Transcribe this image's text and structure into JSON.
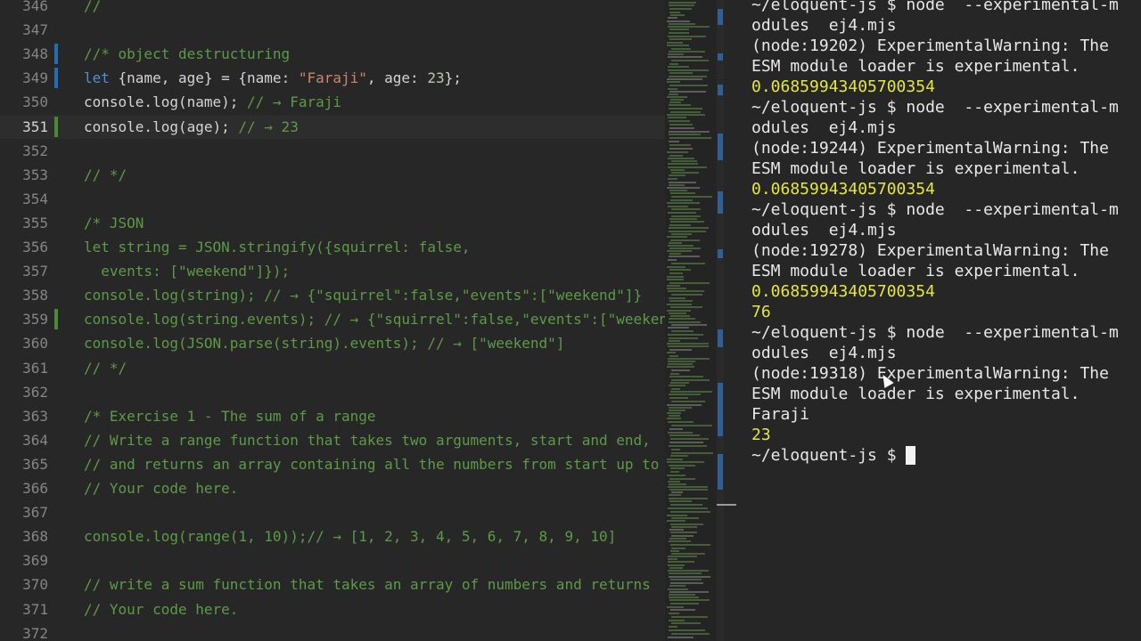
{
  "editor": {
    "current_line": "351",
    "lines": [
      {
        "n": "346",
        "seg": [
          {
            "t": "// ",
            "c": "cm"
          }
        ]
      },
      {
        "n": "347",
        "seg": []
      },
      {
        "n": "348",
        "mark": "#1f6fb2",
        "seg": [
          {
            "t": "//* object destructuring",
            "c": "cm"
          }
        ]
      },
      {
        "n": "349",
        "mark": "#1f6fb2",
        "seg": [
          {
            "t": "let",
            "c": "kw"
          },
          {
            "t": " {name, age} = {name: ",
            "c": ""
          },
          {
            "t": "\"Faraji\"",
            "c": "str"
          },
          {
            "t": ", age: ",
            "c": ""
          },
          {
            "t": "23",
            "c": "num"
          },
          {
            "t": "};",
            "c": ""
          }
        ]
      },
      {
        "n": "350",
        "seg": [
          {
            "t": "console.log(name); ",
            "c": ""
          },
          {
            "t": "// → Faraji",
            "c": "cm"
          }
        ]
      },
      {
        "n": "351",
        "mark": "#4a8a34",
        "cur": true,
        "seg": [
          {
            "t": "console.log(age); ",
            "c": ""
          },
          {
            "t": "// → 23",
            "c": "cm"
          }
        ]
      },
      {
        "n": "352",
        "seg": []
      },
      {
        "n": "353",
        "seg": [
          {
            "t": "// */",
            "c": "cm"
          }
        ]
      },
      {
        "n": "354",
        "seg": []
      },
      {
        "n": "355",
        "seg": [
          {
            "t": "/* JSON",
            "c": "cm"
          }
        ]
      },
      {
        "n": "356",
        "seg": [
          {
            "t": "let string = JSON.stringify({squirrel: false,",
            "c": "cm"
          }
        ]
      },
      {
        "n": "357",
        "seg": [
          {
            "t": "  events: [\"weekend\"]});",
            "c": "cm"
          }
        ]
      },
      {
        "n": "358",
        "seg": [
          {
            "t": "console.log(string); // → {\"squirrel\":false,\"events\":[\"weekend\"]}",
            "c": "cm"
          }
        ]
      },
      {
        "n": "359",
        "mark": "#4a8a34",
        "seg": [
          {
            "t": "console.log(string.events); // → {\"squirrel\":false,\"events\":[\"weekend\"]}",
            "c": "cm"
          }
        ]
      },
      {
        "n": "360",
        "seg": [
          {
            "t": "console.log(JSON.parse(string).events); // → [\"weekend\"]",
            "c": "cm"
          }
        ]
      },
      {
        "n": "361",
        "seg": [
          {
            "t": "// */",
            "c": "cm"
          }
        ]
      },
      {
        "n": "362",
        "seg": []
      },
      {
        "n": "363",
        "seg": [
          {
            "t": "/* Exercise 1 - The sum of a range",
            "c": "cm"
          }
        ]
      },
      {
        "n": "364",
        "seg": [
          {
            "t": "// Write a range function that takes two arguments, start and end,",
            "c": "cm"
          }
        ]
      },
      {
        "n": "365",
        "seg": [
          {
            "t": "// and returns an array containing all the numbers from start up to",
            "c": "cm"
          }
        ]
      },
      {
        "n": "366",
        "seg": [
          {
            "t": "// Your code here.",
            "c": "cm"
          }
        ]
      },
      {
        "n": "367",
        "seg": []
      },
      {
        "n": "368",
        "seg": [
          {
            "t": "console.log(range(1, 10));// → [1, 2, 3, 4, 5, 6, 7, 8, 9, 10]",
            "c": "cm"
          }
        ]
      },
      {
        "n": "369",
        "seg": []
      },
      {
        "n": "370",
        "seg": [
          {
            "t": "// write a sum function that takes an array of numbers and returns",
            "c": "cm"
          }
        ]
      },
      {
        "n": "371",
        "seg": [
          {
            "t": "// Your code here.",
            "c": "cm"
          }
        ]
      },
      {
        "n": "372",
        "seg": []
      }
    ]
  },
  "terminal": {
    "lines": [
      {
        "t": "~/eloquent-js $ node  --experimental-m",
        "k": "cmd"
      },
      {
        "t": "odules  ej4.mjs",
        "k": "cmd"
      },
      {
        "t": "(node:19202) ExperimentalWarning: The",
        "k": "out"
      },
      {
        "t": "ESM module loader is experimental.",
        "k": "out"
      },
      {
        "t": "0.06859943405700354",
        "k": "result"
      },
      {
        "t": "~/eloquent-js $ node  --experimental-m",
        "k": "cmd"
      },
      {
        "t": "odules  ej4.mjs",
        "k": "cmd"
      },
      {
        "t": "(node:19244) ExperimentalWarning: The",
        "k": "out"
      },
      {
        "t": "ESM module loader is experimental.",
        "k": "out"
      },
      {
        "t": "0.06859943405700354",
        "k": "result"
      },
      {
        "t": "~/eloquent-js $ node  --experimental-m",
        "k": "cmd"
      },
      {
        "t": "odules  ej4.mjs",
        "k": "cmd"
      },
      {
        "t": "(node:19278) ExperimentalWarning: The",
        "k": "out"
      },
      {
        "t": "ESM module loader is experimental.",
        "k": "out"
      },
      {
        "t": "0.06859943405700354",
        "k": "result"
      },
      {
        "t": "76",
        "k": "result"
      },
      {
        "t": "~/eloquent-js $ node  --experimental-m",
        "k": "cmd"
      },
      {
        "t": "odules  ej4.mjs",
        "k": "cmd"
      },
      {
        "t": "(node:19318) ExperimentalWarning: The",
        "k": "out"
      },
      {
        "t": "ESM module loader is experimental.",
        "k": "out"
      },
      {
        "t": "Faraji",
        "k": "out"
      },
      {
        "t": "23",
        "k": "result"
      },
      {
        "t": "~/eloquent-js $ ",
        "k": "prompt"
      }
    ],
    "result_color": "#e6e642"
  }
}
